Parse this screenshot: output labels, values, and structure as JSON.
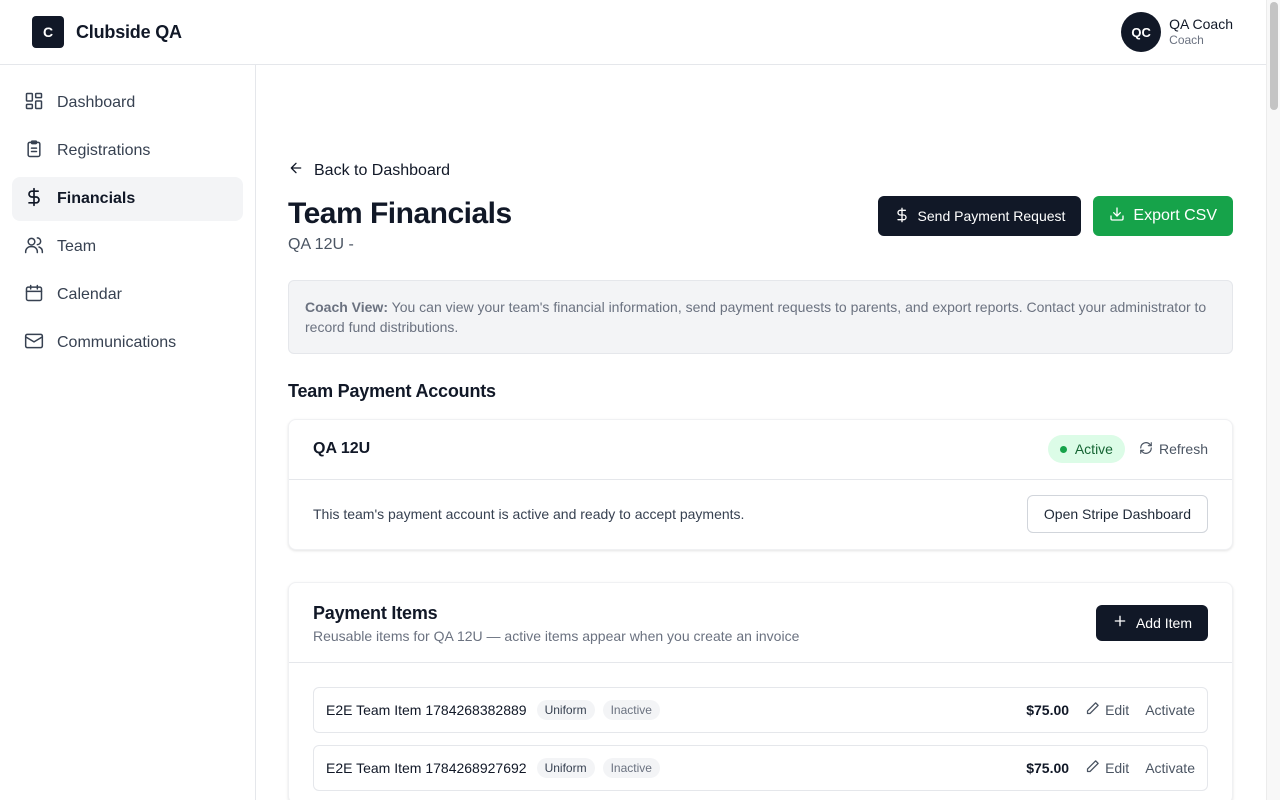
{
  "brand": {
    "logo_letter": "C",
    "name": "Clubside QA"
  },
  "user": {
    "initials": "QC",
    "name": "QA Coach",
    "role": "Coach"
  },
  "sidebar": {
    "items": [
      {
        "label": "Dashboard",
        "icon": "dashboard-icon",
        "active": false
      },
      {
        "label": "Registrations",
        "icon": "clipboard-icon",
        "active": false
      },
      {
        "label": "Financials",
        "icon": "dollar-icon",
        "active": true
      },
      {
        "label": "Team",
        "icon": "users-icon",
        "active": false
      },
      {
        "label": "Calendar",
        "icon": "calendar-icon",
        "active": false
      },
      {
        "label": "Communications",
        "icon": "mail-icon",
        "active": false
      }
    ]
  },
  "main": {
    "back_label": "Back to Dashboard",
    "title": "Team Financials",
    "subtitle": "QA 12U -",
    "send_payment_label": "Send Payment Request",
    "export_label": "Export CSV",
    "notice_strong": "Coach View:",
    "notice_text": " You can view your team's financial information, send payment requests to parents, and export reports. Contact your administrator to record fund distributions."
  },
  "accounts": {
    "section_title": "Team Payment Accounts",
    "account_name": "QA 12U",
    "status": "Active",
    "refresh_label": "Refresh",
    "description": "This team's payment account is active and ready to accept payments.",
    "stripe_label": "Open Stripe Dashboard"
  },
  "payment_items": {
    "title": "Payment Items",
    "description": "Reusable items for QA 12U — active items appear when you create an invoice",
    "add_label": "Add Item",
    "items": [
      {
        "name": "E2E Team Item 1784268382889",
        "category": "Uniform",
        "status": "Inactive",
        "price": "$75.00",
        "edit": "Edit",
        "action": "Activate"
      },
      {
        "name": "E2E Team Item 1784268927692",
        "category": "Uniform",
        "status": "Inactive",
        "price": "$75.00",
        "edit": "Edit",
        "action": "Activate"
      }
    ]
  },
  "colors": {
    "primary_dark": "#111827",
    "success_green": "#16a34a",
    "active_badge_bg": "#dcfce7",
    "active_badge_text": "#166534"
  }
}
